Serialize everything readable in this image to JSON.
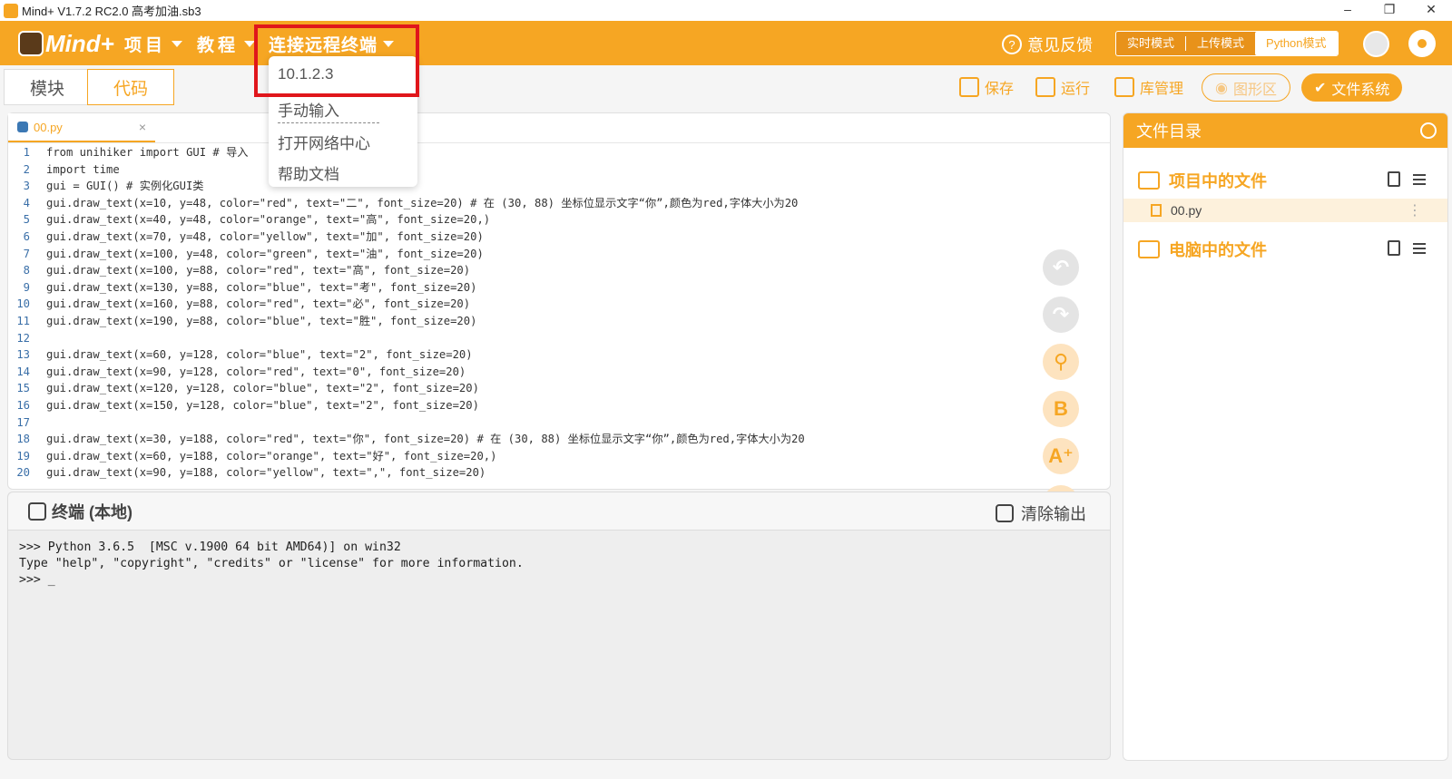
{
  "window": {
    "title": "Mind+ V1.7.2 RC2.0   高考加油.sb3",
    "minimize": "–",
    "restore": "❐",
    "close": "✕"
  },
  "menubar": {
    "logo": "Mind+",
    "items": [
      {
        "label": "项目"
      },
      {
        "label": "教程"
      },
      {
        "label": "连接远程终端"
      }
    ],
    "feedback": "意见反馈",
    "modes": [
      "实时模式",
      "上传模式",
      "Python模式"
    ],
    "active_mode": "Python模式"
  },
  "dropdown": {
    "items": [
      "10.1.2.3",
      "手动输入",
      "打开网络中心",
      "帮助文档"
    ]
  },
  "toolbar": {
    "tabs": [
      "模块",
      "代码"
    ],
    "active_tab": "代码",
    "save": "保存",
    "run": "运行",
    "library": "库管理",
    "graphics": "图形区",
    "filesystem": "文件系统"
  },
  "editor": {
    "tab": "00.py",
    "lines": [
      {
        "n": "1",
        "t": "from unihiker import GUI # 导入"
      },
      {
        "n": "2",
        "t": "import time"
      },
      {
        "n": "3",
        "t": "gui = GUI() # 实例化GUI类"
      },
      {
        "n": "4",
        "t": "gui.draw_text(x=10, y=48, color=\"red\", text=\"二\", font_size=20) # 在 (30, 88) 坐标位显示文字“你”,颜色为red,字体大小为20"
      },
      {
        "n": "5",
        "t": "gui.draw_text(x=40, y=48, color=\"orange\", text=\"高\", font_size=20,)"
      },
      {
        "n": "6",
        "t": "gui.draw_text(x=70, y=48, color=\"yellow\", text=\"加\", font_size=20)"
      },
      {
        "n": "7",
        "t": "gui.draw_text(x=100, y=48, color=\"green\", text=\"油\", font_size=20)"
      },
      {
        "n": "8",
        "t": "gui.draw_text(x=100, y=88, color=\"red\", text=\"高\", font_size=20)"
      },
      {
        "n": "9",
        "t": "gui.draw_text(x=130, y=88, color=\"blue\", text=\"考\", font_size=20)"
      },
      {
        "n": "10",
        "t": "gui.draw_text(x=160, y=88, color=\"red\", text=\"必\", font_size=20)"
      },
      {
        "n": "11",
        "t": "gui.draw_text(x=190, y=88, color=\"blue\", text=\"胜\", font_size=20)"
      },
      {
        "n": "12",
        "t": ""
      },
      {
        "n": "13",
        "t": "gui.draw_text(x=60, y=128, color=\"blue\", text=\"2\", font_size=20)"
      },
      {
        "n": "14",
        "t": "gui.draw_text(x=90, y=128, color=\"red\", text=\"0\", font_size=20)"
      },
      {
        "n": "15",
        "t": "gui.draw_text(x=120, y=128, color=\"blue\", text=\"2\", font_size=20)"
      },
      {
        "n": "16",
        "t": "gui.draw_text(x=150, y=128, color=\"blue\", text=\"2\", font_size=20)"
      },
      {
        "n": "17",
        "t": ""
      },
      {
        "n": "18",
        "t": "gui.draw_text(x=30, y=188, color=\"red\", text=\"你\", font_size=20) # 在 (30, 88) 坐标位显示文字“你”,颜色为red,字体大小为20"
      },
      {
        "n": "19",
        "t": "gui.draw_text(x=60, y=188, color=\"orange\", text=\"好\", font_size=20,)"
      },
      {
        "n": "20",
        "t": "gui.draw_text(x=90, y=188, color=\"yellow\", text=\",\", font_size=20)"
      }
    ]
  },
  "terminal": {
    "title": "终端 (本地)",
    "clear": "清除输出",
    "output": ">>> Python 3.6.5  [MSC v.1900 64 bit AMD64)] on win32\nType \"help\", \"copyright\", \"credits\" or \"license\" for more information.\n>>> _"
  },
  "filepanel": {
    "title": "文件目录",
    "project_files": "项目中的文件",
    "file": "00.py",
    "computer_files": "电脑中的文件"
  },
  "colors": {
    "accent": "#f6a623",
    "highlight": "#e0161b"
  }
}
